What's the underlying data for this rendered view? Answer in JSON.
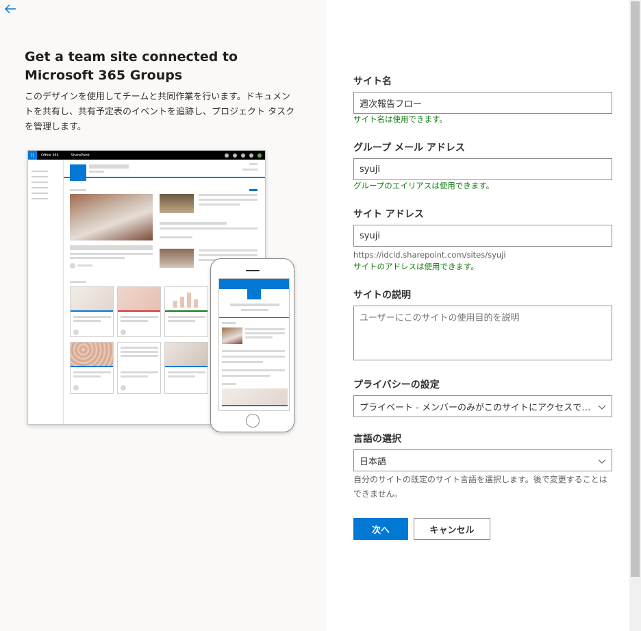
{
  "left_panel": {
    "back_icon": "arrow-left-icon",
    "title": "Get a team site connected to Microsoft 365 Groups",
    "description": "このデザインを使用してチームと共同作業を行います。ドキュメントを共有し、共有予定表のイベントを追跡し、プロジェクト タスクを管理します。",
    "preview": {
      "brand_label": "Office 365",
      "app_label": "SharePoint"
    }
  },
  "form": {
    "site_name": {
      "label": "サイト名",
      "value": "週次報告フロー",
      "status": "サイト名は使用できます。"
    },
    "group_email": {
      "label": "グループ メール アドレス",
      "value": "syuji",
      "status": "グループのエイリアスは使用できます。"
    },
    "site_address": {
      "label": "サイト アドレス",
      "value": "syuji",
      "url": "https://idcld.sharepoint.com/sites/syuji",
      "status": "サイトのアドレスは使用できます。"
    },
    "site_description": {
      "label": "サイトの説明",
      "placeholder": "ユーザーにこのサイトの使用目的を説明"
    },
    "privacy": {
      "label": "プライバシーの設定",
      "selected": "プライベート - メンバーのみがこのサイトにアクセスできます"
    },
    "language": {
      "label": "言語の選択",
      "selected": "日本語",
      "help": "自分のサイトの既定のサイト言語を選択します。後で変更することはできません。"
    },
    "buttons": {
      "next": "次へ",
      "cancel": "キャンセル"
    }
  },
  "colors": {
    "accent": "#0078d4",
    "success": "#107c10",
    "left_bg": "#faf9f8"
  }
}
